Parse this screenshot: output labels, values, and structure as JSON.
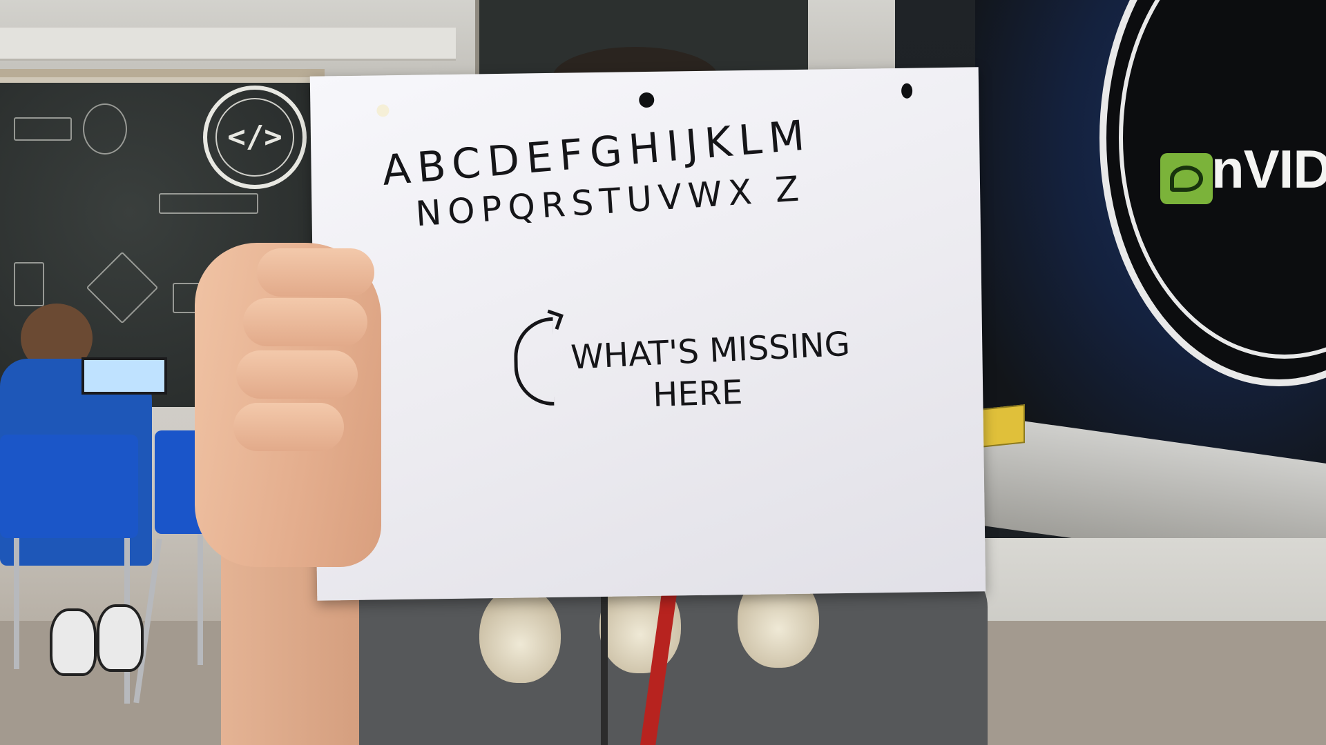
{
  "photo": {
    "description_free": true,
    "sign": {
      "alphabet_line_1": "ABCDEFGHIJKLM",
      "alphabet_line_2": "NOPQRSTUVWX Z",
      "question_line_1": "WHAT'S MISSING",
      "question_line_2": "HERE"
    },
    "nvidia_logo": {
      "wordmark": "nVIDIA",
      "color": "#76b900"
    },
    "chalkboard_logo": {
      "glyph": "</>"
    },
    "colors": {
      "paper": "#f2f2f6",
      "ink": "#151518",
      "chair_blue": "#1b56c8",
      "chalkboard": "#2b2f2e",
      "nvidia_green": "#76b900"
    }
  }
}
